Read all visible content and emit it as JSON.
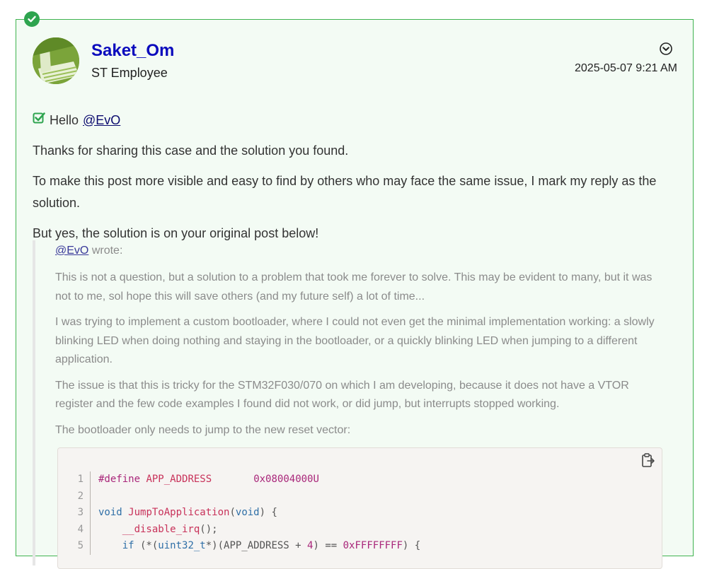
{
  "author": {
    "name": "Saket_Om",
    "role": "ST Employee",
    "date": "2025-05-07 9:21 AM"
  },
  "reply": {
    "greeting": "Hello",
    "mention": "@EvO",
    "paragraphs": [
      "Thanks for sharing this case and the solution you found.",
      "To make this post more visible and easy to find by others who may face the same issue, I mark my reply as the solution.",
      "But yes, the solution is on your original post below!"
    ]
  },
  "quote": {
    "author_mention": "@EvO",
    "wrote_label": "wrote:",
    "paragraphs": [
      "This is not a question, but a solution to a problem that took me forever to solve. This may be evident to many, but it was not to me, sol hope this will save others (and my future self) a lot of time...",
      "I was trying to implement a custom bootloader, where I could not even get the minimal implementation working: a slowly blinking LED when doing nothing and staying in the bootloader, or a quickly blinking LED when jumping to a different application.",
      "The issue is that this is tricky for the STM32F030/070 on which I am developing, because it does not have a VTOR register and the few code examples I found did not work, or did jump, but interrupts stopped working.",
      "The bootloader only needs to jump to the new reset vector:"
    ]
  },
  "code": {
    "line_numbers": [
      "1",
      "2",
      "3",
      "4",
      "5"
    ],
    "line1": {
      "directive": "#define",
      "name": "APP_ADDRESS",
      "value": "0x08004000U"
    },
    "line3": {
      "type": "void",
      "func": "JumpToApplication",
      "open": "(",
      "arg": "void",
      "close": ") {"
    },
    "line4": {
      "call": "__disable_irq",
      "rest": "();"
    },
    "line5": {
      "kw": "if",
      "p1": " (*(",
      "cast": "uint32_t",
      "p2": "*)(APP_ADDRESS + ",
      "n": "4",
      "p3": ") == ",
      "hex": "0xFFFFFFFF",
      "p4": ") {"
    }
  },
  "icons": {
    "solved": "check-circle-icon",
    "menu": "chevron-down-circle-icon",
    "accepted": "checkbox-checked-icon",
    "copy": "clipboard-copy-icon"
  },
  "colors": {
    "accent_green": "#2ea44f",
    "author_link": "#0b0bbd",
    "post_bg": "#f3fbf4"
  }
}
